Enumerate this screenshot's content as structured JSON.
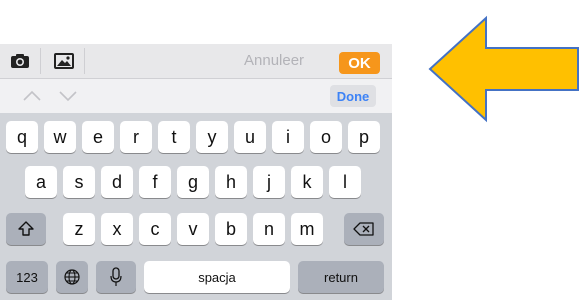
{
  "toolbar": {
    "cancel_label": "Annuleer",
    "ok_label": "OK",
    "ok_color": "#f6961b"
  },
  "accessory": {
    "done_label": "Done"
  },
  "keyboard": {
    "row1": [
      "q",
      "w",
      "e",
      "r",
      "t",
      "y",
      "u",
      "i",
      "o",
      "p"
    ],
    "row2": [
      "a",
      "s",
      "d",
      "f",
      "g",
      "h",
      "j",
      "k",
      "l"
    ],
    "row3": [
      "z",
      "x",
      "c",
      "v",
      "b",
      "n",
      "m"
    ],
    "numbers_label": "123",
    "space_label": "spacja",
    "return_label": "return"
  },
  "icons": {
    "camera": "camera-icon",
    "image": "image-icon",
    "chevron_up": "chevron-up-icon",
    "chevron_down": "chevron-down-icon",
    "shift": "shift-icon",
    "backspace": "backspace-icon",
    "globe": "globe-icon",
    "microphone": "microphone-icon"
  },
  "annotation": {
    "arrow_color": "#ffc000",
    "arrow_outline": "#4472c4"
  }
}
